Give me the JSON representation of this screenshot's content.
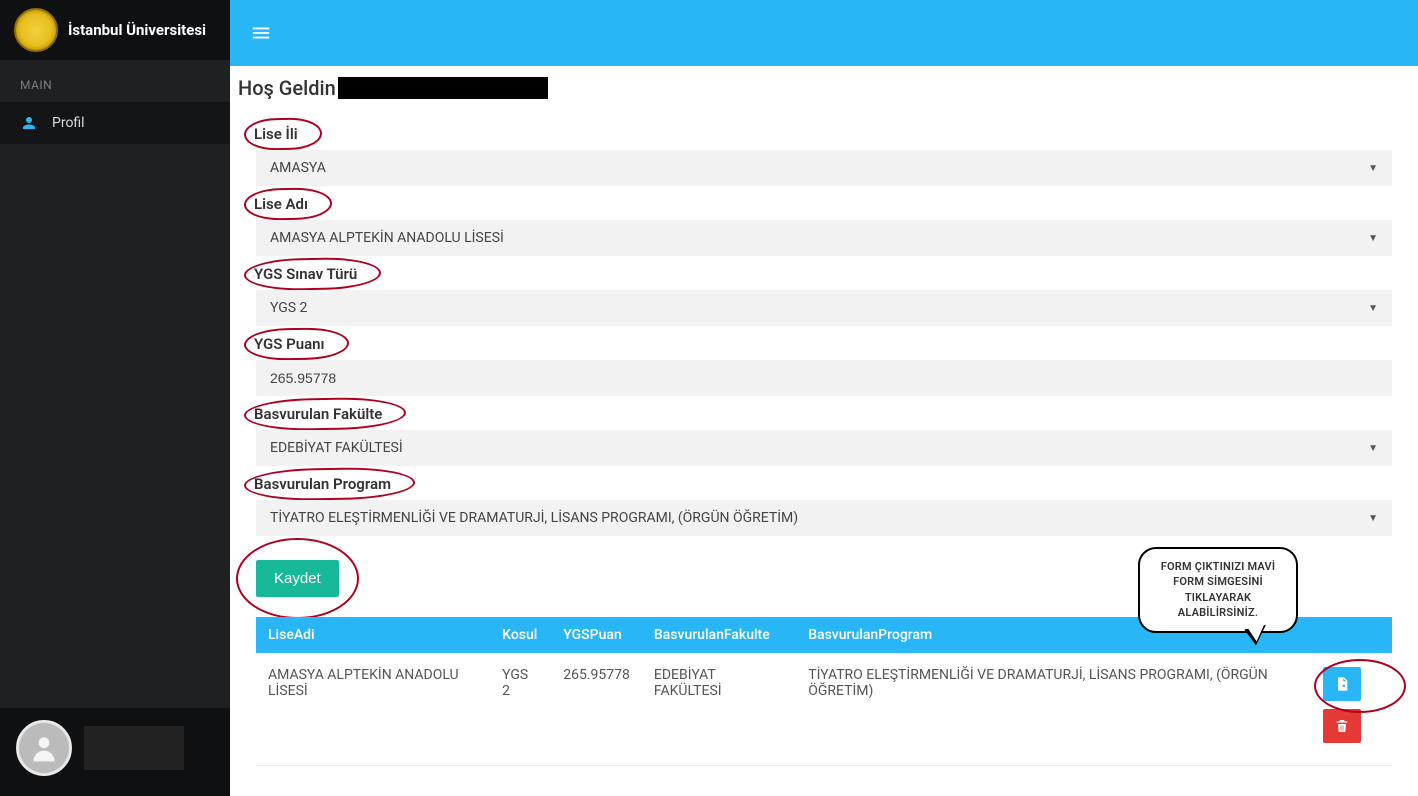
{
  "app": {
    "title": "İstanbul Üniversitesi"
  },
  "sidebar": {
    "section_label": "MAIN",
    "items": [
      {
        "label": "Profil"
      }
    ]
  },
  "welcome_prefix": "Hoş Geldin ",
  "form": {
    "lise_ili": {
      "label": "Lise İli",
      "value": "AMASYA"
    },
    "lise_adi": {
      "label": "Lise Adı",
      "value": "AMASYA ALPTEKİN ANADOLU LİSESİ"
    },
    "ygs_tur": {
      "label": "YGS Sınav Türü",
      "value": "YGS 2"
    },
    "ygs_puan": {
      "label": "YGS Puanı",
      "value": "265.95778"
    },
    "fakulte": {
      "label": "Basvurulan Fakülte",
      "value": "EDEBİYAT FAKÜLTESİ"
    },
    "program": {
      "label": "Basvurulan Program",
      "value": "TİYATRO ELEŞTİRMENLİĞİ VE DRAMATURJİ, LİSANS PROGRAMI, (ÖRGÜN ÖĞRETİM)"
    }
  },
  "save_label": "Kaydet",
  "table": {
    "headers": {
      "lise_adi": "LiseAdi",
      "kosul": "Kosul",
      "ygs_puan": "YGSPuan",
      "fakulte": "BasvurulanFakulte",
      "program": "BasvurulanProgram"
    },
    "rows": [
      {
        "lise_adi": "AMASYA ALPTEKİN ANADOLU LİSESİ",
        "kosul": "YGS 2",
        "ygs_puan": "265.95778",
        "fakulte": "EDEBİYAT FAKÜLTESİ",
        "program": "TİYATRO ELEŞTİRMENLİĞİ VE DRAMATURJİ, LİSANS PROGRAMI, (ÖRGÜN ÖĞRETİM)"
      }
    ]
  },
  "speech_bubble": "FORM ÇIKTINIZI MAVİ FORM SİMGESİNİ TIKLAYARAK ALABİLİRSİNİZ.",
  "colors": {
    "accent": "#29b6f6",
    "save": "#18b89a",
    "danger": "#e53935",
    "annot": "#b00020"
  }
}
